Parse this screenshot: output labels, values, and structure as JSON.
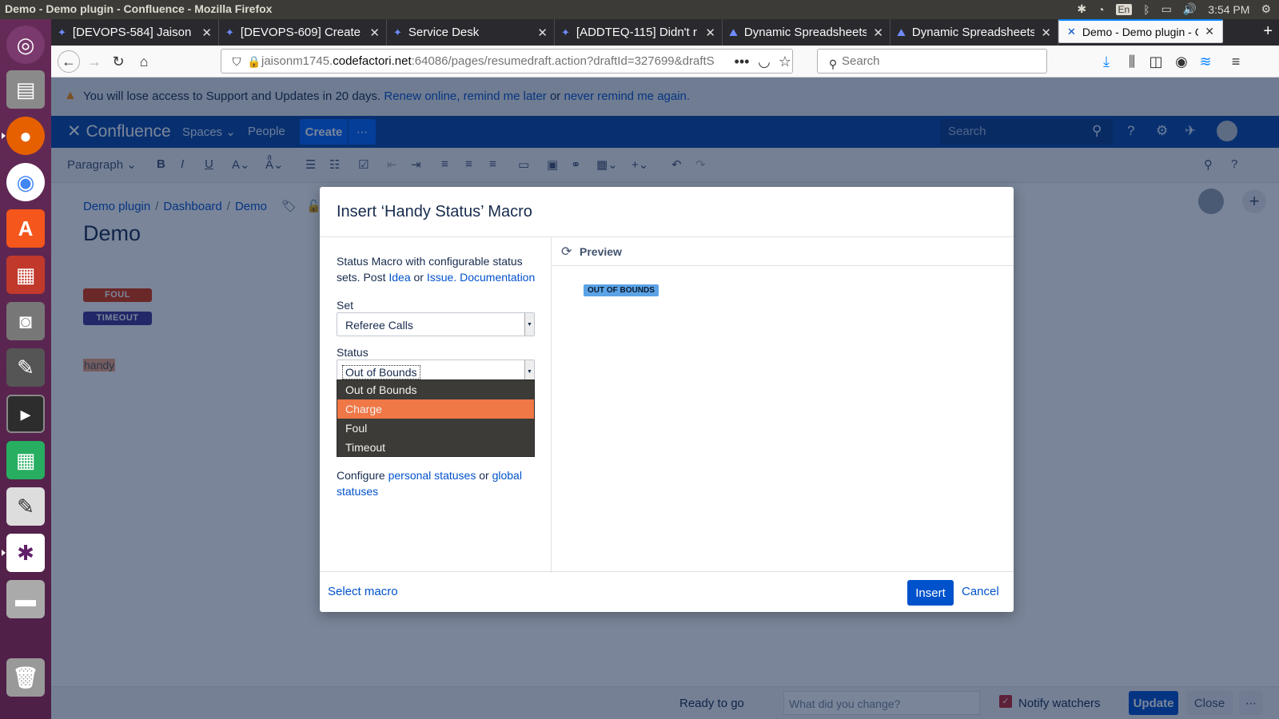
{
  "system": {
    "window_title": "Demo - Demo plugin - Confluence - Mozilla Firefox",
    "keyboard": "En",
    "clock": "3:54 PM"
  },
  "browser": {
    "tabs": [
      {
        "label": "[DEVOPS-584] Jaison M"
      },
      {
        "label": "[DEVOPS-609] Create t"
      },
      {
        "label": "Service Desk"
      },
      {
        "label": "[ADDTEQ-115] Didn't r"
      },
      {
        "label": "Dynamic Spreadsheets"
      },
      {
        "label": "Dynamic Spreadsheets"
      },
      {
        "label": "Demo - Demo plugin - C"
      }
    ],
    "url_prefix": "jaisonm1745.",
    "url_domain": "codefactori.net",
    "url_rest": ":64086/pages/resumedraft.action?draftId=327699&draftS",
    "search_placeholder": "Search"
  },
  "banner": {
    "text": "You will lose access to Support and Updates in 20 days.",
    "renew": "Renew online,",
    "remind": "remind me later",
    "or": "or",
    "never": "never remind me again."
  },
  "header": {
    "logo": "Confluence",
    "spaces": "Spaces",
    "people": "People",
    "create": "Create",
    "search_placeholder": "Search"
  },
  "toolbar": {
    "paragraph": "Paragraph"
  },
  "page": {
    "breadcrumbs": [
      "Demo plugin",
      "Dashboard",
      "Demo"
    ],
    "title": "Demo",
    "lozenges": [
      {
        "text": "FOUL",
        "color": "#de350b"
      },
      {
        "text": "TIMEOUT",
        "color": "#403294"
      }
    ],
    "handy_text": "handy"
  },
  "dialog": {
    "title": "Insert ‘Handy Status’ Macro",
    "desc_text": "Status Macro with configurable status sets. Post",
    "idea": "Idea",
    "or": "or",
    "issue": "Issue.",
    "documentation": "Documentation",
    "set_label": "Set",
    "set_value": "Referee Calls",
    "status_label": "Status",
    "status_value": "Out of Bounds",
    "options": [
      "Out of Bounds",
      "Charge",
      "Foul",
      "Timeout"
    ],
    "highlighted_option": "Charge",
    "configure": "Configure",
    "personal": "personal statuses",
    "or2": "or",
    "global": "global statuses",
    "preview_label": "Preview",
    "preview_status": "OUT OF BOUNDS",
    "select_macro": "Select macro",
    "insert": "Insert",
    "cancel": "Cancel"
  },
  "footer": {
    "ready": "Ready to go",
    "change_placeholder": "What did you change?",
    "notify": "Notify watchers",
    "update": "Update",
    "close": "Close"
  }
}
